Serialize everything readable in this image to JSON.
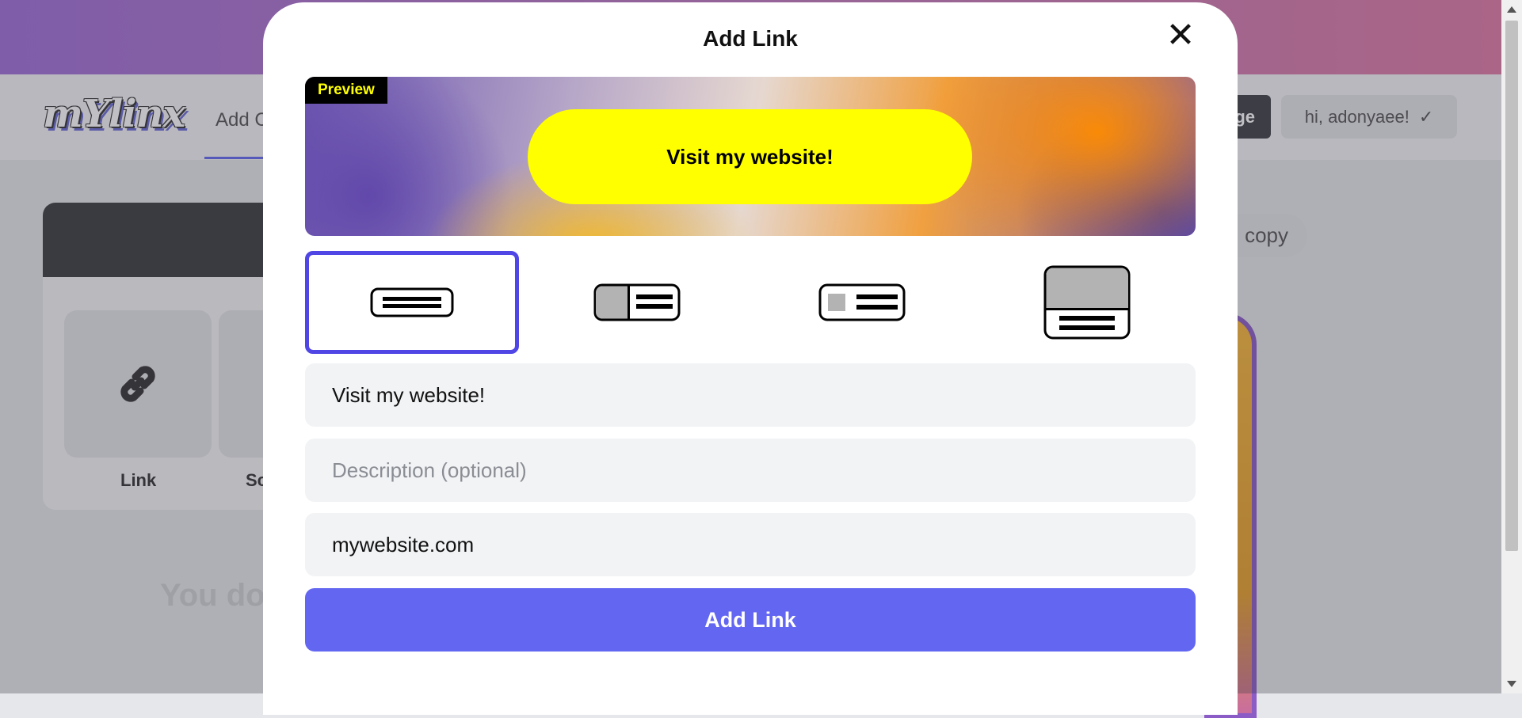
{
  "background": {
    "logo": "mYlinx",
    "nav_tab": "Add C",
    "manage_button": "ge",
    "user_greeting": "hi, adonyaee!",
    "user_check": "✓",
    "copy_button": "copy",
    "tiles": [
      {
        "label": "Link",
        "icon": "link-icon"
      },
      {
        "label": "Sc"
      }
    ],
    "empty_message": "You do"
  },
  "modal": {
    "title": "Add Link",
    "close_icon": "✕",
    "preview": {
      "badge": "Preview",
      "button_label": "Visit my website!",
      "button_color": "#ffff00"
    },
    "layouts": [
      {
        "name": "text-only",
        "selected": true
      },
      {
        "name": "thumbnail-left"
      },
      {
        "name": "small-icon-left"
      },
      {
        "name": "image-top"
      }
    ],
    "fields": {
      "title_value": "Visit my website!",
      "description_placeholder": "Description (optional)",
      "description_value": "",
      "url_value": "mywebsite.com"
    },
    "submit_label": "Add Link",
    "accent_color": "#6366f1"
  }
}
